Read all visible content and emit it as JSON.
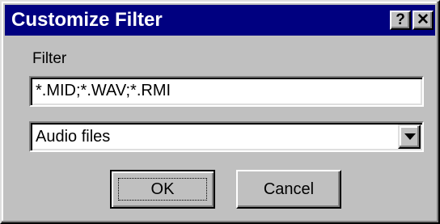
{
  "window": {
    "title": "Customize Filter",
    "help_label": "?",
    "close_label": "✕"
  },
  "filter": {
    "label": "Filter",
    "value": "*.MID;*.WAV;*.RMI"
  },
  "type_select": {
    "selected": "Audio files",
    "icon": "chevron-down-icon"
  },
  "buttons": {
    "ok_label": "OK",
    "cancel_label": "Cancel"
  },
  "colors": {
    "titlebar": "#000080",
    "face": "#c0c0c0"
  }
}
